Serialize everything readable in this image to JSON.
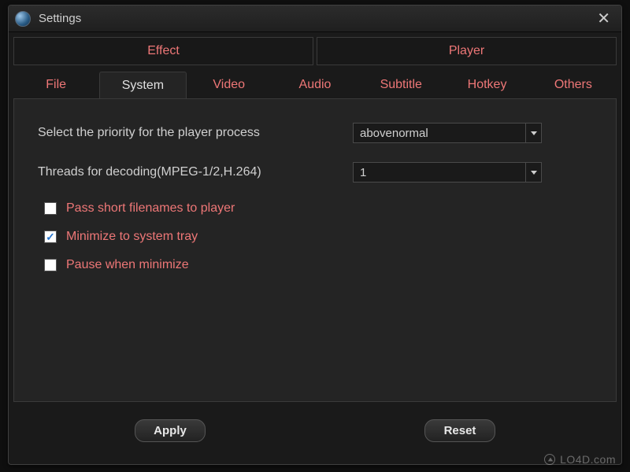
{
  "title": "Settings",
  "main_tabs": {
    "effect": "Effect",
    "player": "Player",
    "active": "player"
  },
  "sub_tabs": {
    "items": [
      "File",
      "System",
      "Video",
      "Audio",
      "Subtitle",
      "Hotkey",
      "Others"
    ],
    "active_index": 1
  },
  "panel": {
    "priority_label": "Select the priority for the player process",
    "priority_value": "abovenormal",
    "threads_label": "Threads for decoding(MPEG-1/2,H.264)",
    "threads_value": "1",
    "checkboxes": [
      {
        "label": "Pass short filenames to player",
        "checked": false
      },
      {
        "label": "Minimize to system tray",
        "checked": true
      },
      {
        "label": "Pause when minimize",
        "checked": false
      }
    ]
  },
  "buttons": {
    "apply": "Apply",
    "reset": "Reset"
  },
  "watermark": "LO4D.com",
  "colors": {
    "accent": "#e77",
    "bg": "#1a1a1a",
    "panel": "#242424"
  }
}
